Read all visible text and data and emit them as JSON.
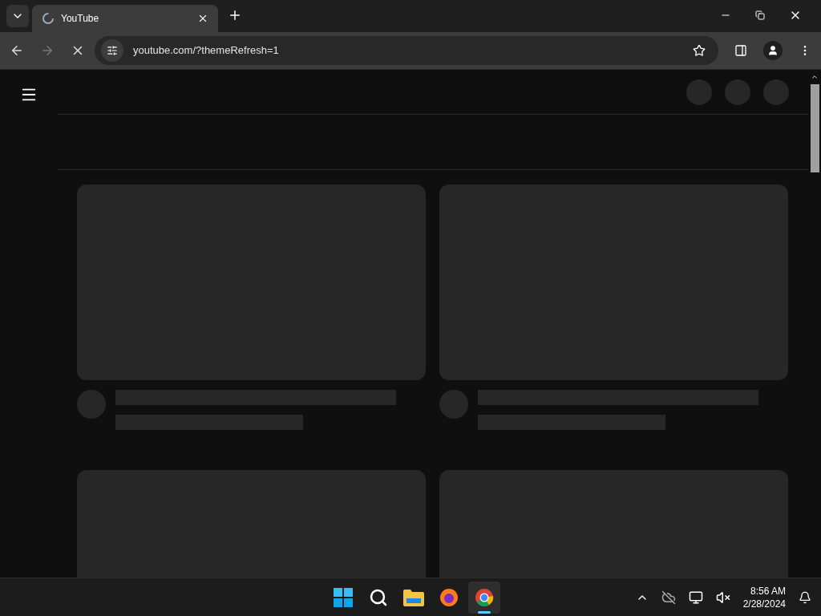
{
  "tabs": [
    {
      "title": "YouTube",
      "selected": true
    }
  ],
  "address": "youtube.com/?themeRefresh=1",
  "taskbar": {
    "apps": [
      {
        "kind": "start",
        "selected": false
      },
      {
        "kind": "search",
        "selected": false
      },
      {
        "kind": "files",
        "selected": false
      },
      {
        "kind": "firefox",
        "selected": false
      },
      {
        "kind": "chrome",
        "selected": true
      }
    ],
    "time": "8:56 AM",
    "date": "2/28/2024"
  }
}
